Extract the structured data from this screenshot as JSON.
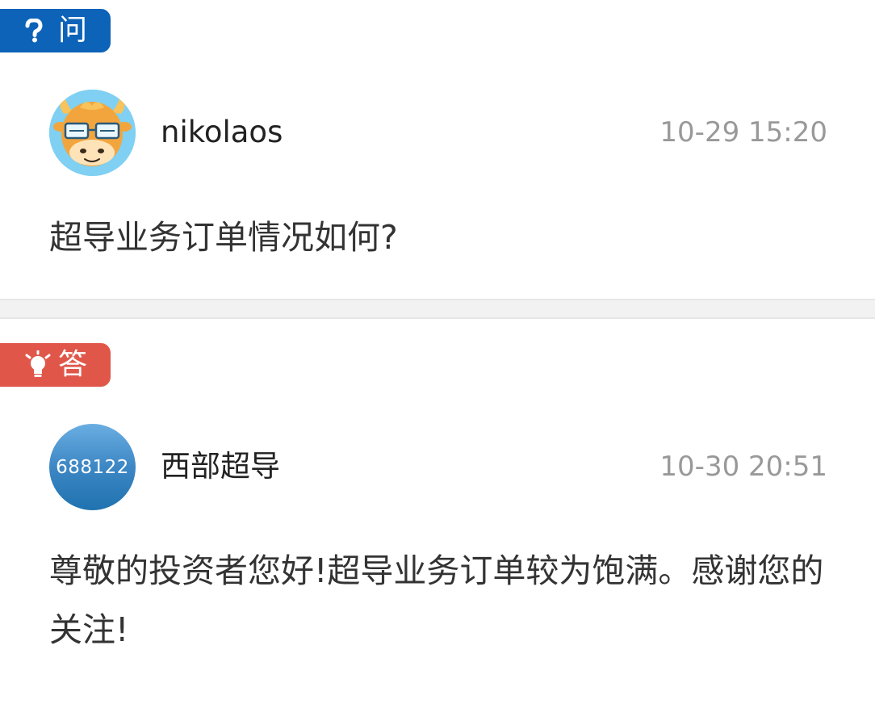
{
  "question": {
    "badge_label": "问",
    "badge_icon": "question-mark-icon",
    "badge_color": "#0c63b8",
    "user": {
      "name": "nikolaos",
      "avatar": "cartoon-cow-avatar"
    },
    "time": "10-29 15:20",
    "text": "超导业务订单情况如何?"
  },
  "answer": {
    "badge_label": "答",
    "badge_icon": "lightbulb-icon",
    "badge_color": "#e0574a",
    "user": {
      "name": "西部超导",
      "avatar_code": "688122"
    },
    "time": "10-30 20:51",
    "text": "尊敬的投资者您好!超导业务订单较为饱满。感谢您的关注!"
  }
}
